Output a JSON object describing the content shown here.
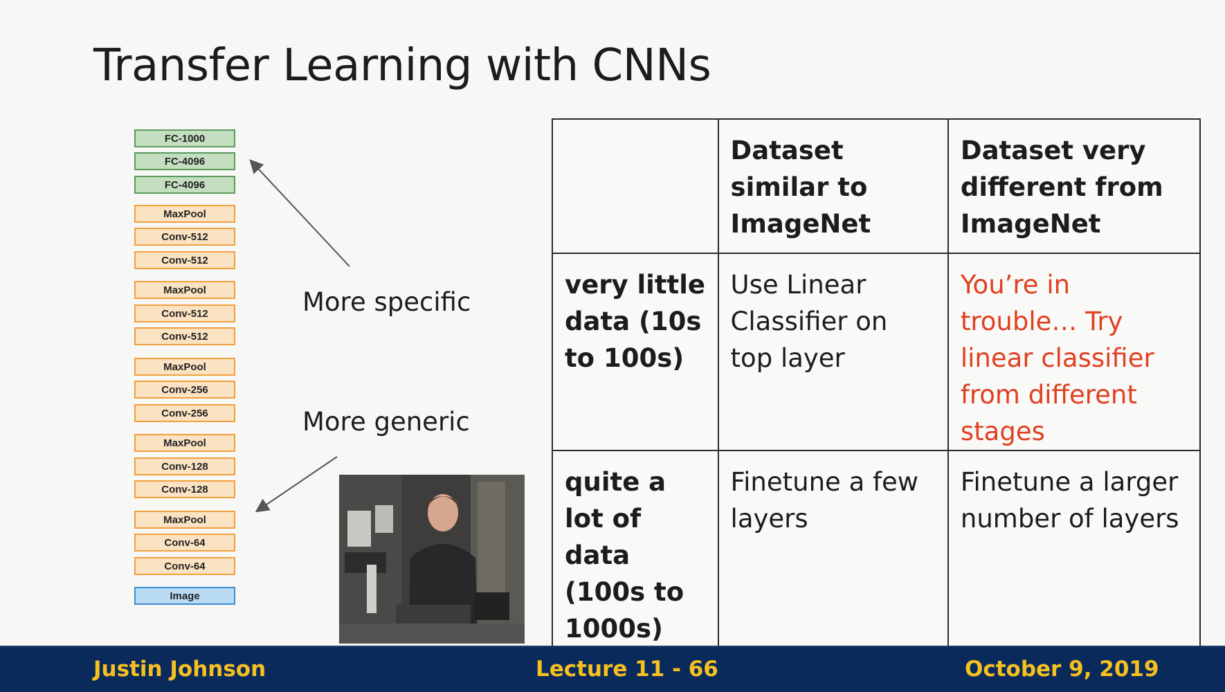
{
  "slide": {
    "title": "Transfer Learning with CNNs"
  },
  "layers": [
    {
      "label": "FC-1000",
      "kind": "fc"
    },
    {
      "label": "FC-4096",
      "kind": "fc"
    },
    {
      "label": "FC-4096",
      "kind": "fc"
    },
    {
      "label": "MaxPool",
      "kind": "conv"
    },
    {
      "label": "Conv-512",
      "kind": "conv"
    },
    {
      "label": "Conv-512",
      "kind": "conv"
    },
    {
      "label": "MaxPool",
      "kind": "conv"
    },
    {
      "label": "Conv-512",
      "kind": "conv"
    },
    {
      "label": "Conv-512",
      "kind": "conv"
    },
    {
      "label": "MaxPool",
      "kind": "conv"
    },
    {
      "label": "Conv-256",
      "kind": "conv"
    },
    {
      "label": "Conv-256",
      "kind": "conv"
    },
    {
      "label": "MaxPool",
      "kind": "conv"
    },
    {
      "label": "Conv-128",
      "kind": "conv"
    },
    {
      "label": "Conv-128",
      "kind": "conv"
    },
    {
      "label": "MaxPool",
      "kind": "conv"
    },
    {
      "label": "Conv-64",
      "kind": "conv"
    },
    {
      "label": "Conv-64",
      "kind": "conv"
    },
    {
      "label": "Image",
      "kind": "img"
    }
  ],
  "annotations": {
    "specific": "More specific",
    "generic": "More generic"
  },
  "table": {
    "header": [
      "",
      "Dataset similar to ImageNet",
      "Dataset very different from ImageNet"
    ],
    "rows": [
      {
        "label": "very little data (10s to 100s)",
        "similar": "Use Linear Classifier on top layer",
        "different": "You’re in trouble… Try linear classifier from different stages"
      },
      {
        "label": "quite a lot of data (100s to 1000s)",
        "similar": "Finetune a few layers",
        "different": "Finetune a larger number of layers"
      }
    ]
  },
  "footer": {
    "author": "Justin Johnson",
    "lecture": "Lecture 11 - 66",
    "date": "October 9, 2019"
  },
  "colors": {
    "footer_bg": "#0b2a5c",
    "footer_text": "#f5c020",
    "warning_text": "#e0401f",
    "fc_fill": "#c4dfc0",
    "conv_fill": "#fbe2c2",
    "image_fill": "#b9dcf4"
  }
}
